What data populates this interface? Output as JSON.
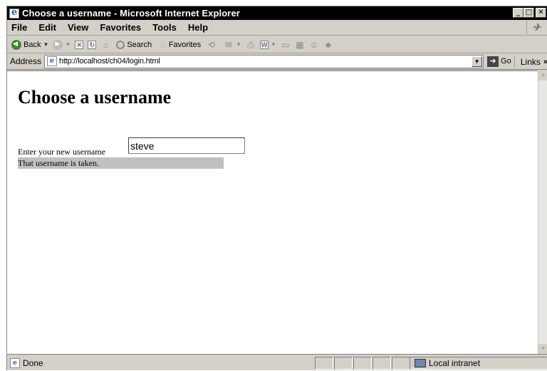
{
  "window": {
    "title": "Choose a username - Microsoft Internet Explorer"
  },
  "menubar": {
    "items": [
      "File",
      "Edit",
      "View",
      "Favorites",
      "Tools",
      "Help"
    ]
  },
  "toolbar": {
    "back_label": "Back",
    "search_label": "Search",
    "favorites_label": "Favorites"
  },
  "addressbar": {
    "label": "Address",
    "url": "http://localhost/ch04/login.html",
    "go_label": "Go",
    "links_label": "Links"
  },
  "page": {
    "heading": "Choose a username",
    "prompt_label": "Enter your new username",
    "username_value": "steve",
    "status_message": "That username is taken."
  },
  "statusbar": {
    "status_text": "Done",
    "zone_label": "Local intranet"
  }
}
